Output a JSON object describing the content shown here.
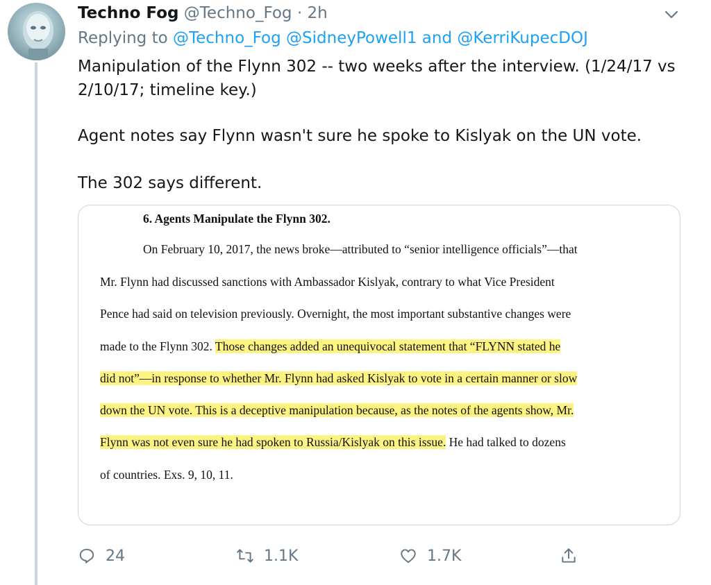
{
  "tweet": {
    "author_name": "Techno Fog",
    "handle": "@Techno_Fog",
    "time": "· 2h",
    "replying_prefix": "Replying to",
    "replying_to": "@Techno_Fog @SidneyPowell1 and @KerriKupecDOJ",
    "text_line1": "Manipulation of the Flynn 302 -- two weeks after the interview. (1/24/17 vs",
    "text_line2": "2/10/17; timeline key.)",
    "text_line3": "Agent notes say Flynn wasn't sure he spoke to Kislyak on the UN vote.",
    "text_line4": "The 302 says different."
  },
  "document": {
    "heading": "6. Agents Manipulate the Flynn 302.",
    "line1": "On February 10, 2017, the news broke—attributed to “senior intelligence officials”—that",
    "line2": "Mr. Flynn had discussed sanctions with Ambassador Kislyak, contrary to what Vice President",
    "line3": "Pence had said on television previously.  Overnight, the most important substantive changes were",
    "line4a": "made to the Flynn 302.  ",
    "line4b": "Those changes added an unequivocal statement that “FLYNN stated he",
    "line5": "did not”—in response to whether Mr. Flynn had asked Kislyak to vote in a certain manner or slow",
    "line6": "down the UN vote.  This is a deceptive manipulation because, as the notes of the agents show, Mr.",
    "line7a": "Flynn was not even sure he had spoken to Russia/Kislyak on this issue.",
    "line7b": "  He had talked to dozens",
    "line8": "of countries.  Exs. 9, 10, 11."
  },
  "actions": {
    "reply_count": "24",
    "retweet_count": "1.1K",
    "like_count": "1.7K"
  },
  "icons": [
    "avatar",
    "chevron-down-icon",
    "reply-icon",
    "retweet-icon",
    "like-icon",
    "share-icon"
  ],
  "colors": {
    "link": "#1da1f2",
    "secondary": "#657786",
    "highlight": "#fdf383",
    "thread_line": "#ccd6dd"
  }
}
